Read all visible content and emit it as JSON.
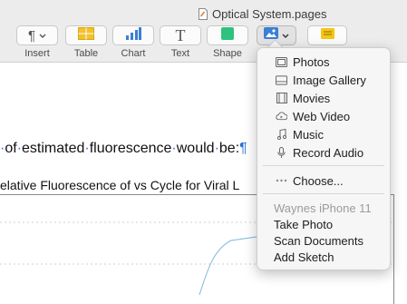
{
  "window": {
    "title": "Optical System.pages"
  },
  "toolbar": {
    "insert_label": "Insert",
    "table_label": "Table",
    "chart_label": "Chart",
    "text_label": "Text",
    "shape_label": "Shape",
    "text_icon_glyph": "T",
    "insert_icon_glyph": "¶"
  },
  "document": {
    "body_words": [
      "of",
      "estimated",
      "fluorescence",
      "would",
      "be:"
    ],
    "pilcrow": "¶",
    "chart_title": "elative Fluorescence of vs Cycle for Viral L"
  },
  "media_menu": {
    "items": [
      {
        "label": "Photos",
        "icon": "photos-icon"
      },
      {
        "label": "Image Gallery",
        "icon": "image-gallery-icon"
      },
      {
        "label": "Movies",
        "icon": "movies-icon"
      },
      {
        "label": "Web Video",
        "icon": "web-video-icon"
      },
      {
        "label": "Music",
        "icon": "music-icon"
      },
      {
        "label": "Record Audio",
        "icon": "microphone-icon"
      }
    ],
    "choose_label": "Choose...",
    "device_header": "Waynes iPhone 11",
    "device_items": [
      "Take Photo",
      "Scan Documents",
      "Add Sketch"
    ]
  },
  "colors": {
    "accent": "#2a72d6",
    "table_icon": "#f2c12e",
    "chart_icon": "#3a7fd5",
    "shape_icon": "#2ec27e",
    "comment_icon": "#f5c518"
  }
}
